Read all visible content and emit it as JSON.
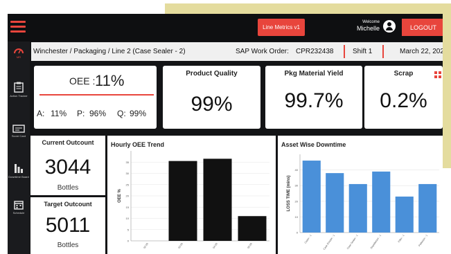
{
  "topbar": {
    "metrics_label": "Line Metrics v1",
    "welcome_label": "Welcome",
    "user_name": "Michelle",
    "logout_label": "LOGOUT",
    "accent_color": "#e8453c"
  },
  "sidebar": {
    "items": [
      {
        "label": "MR",
        "icon": "gauge-icon"
      },
      {
        "label": "Action Tracker",
        "icon": "clipboard-icon"
      },
      {
        "label": "Score Card",
        "icon": "scorecard-icon"
      },
      {
        "label": "Downtime Board",
        "icon": "bar-chart-icon"
      },
      {
        "label": "Schedule",
        "icon": "calendar-icon"
      }
    ]
  },
  "infobar": {
    "breadcrumb": "Winchester / Packaging / Line 2 (Case Sealer - 2)",
    "work_order_label": "SAP Work Order:",
    "work_order_value": "CPR232438",
    "shift": "Shift 1",
    "date": "March 22, 202"
  },
  "kpis": {
    "oee": {
      "label": "OEE :",
      "value": "11%",
      "a_label": "A:",
      "a_value": "11%",
      "p_label": "P:",
      "p_value": "96%",
      "q_label": "Q:",
      "q_value": "99%"
    },
    "quality": {
      "title": "Product Quality",
      "value": "99%"
    },
    "yield": {
      "title": "Pkg Material Yield",
      "value": "99.7%"
    },
    "scrap": {
      "title": "Scrap",
      "value": "0.2%"
    }
  },
  "outcomes": {
    "current": {
      "title": "Current Outcount",
      "value": "3044",
      "unit": "Bottles"
    },
    "target": {
      "title": "Target Outcount",
      "value": "5011",
      "unit": "Bottles"
    }
  },
  "chart_data": [
    {
      "type": "bar",
      "title": "Hourly OEE Trend",
      "ylabel": "OEE %",
      "xlabel": "",
      "categories": [
        "02:00",
        "03:00",
        "04:00",
        "05:00"
      ],
      "values": [
        0,
        35.5,
        36.5,
        11
      ],
      "ylim": [
        0,
        40
      ],
      "yticks": [
        0,
        5,
        10,
        15,
        20,
        25,
        30,
        35
      ],
      "grid": true,
      "color": "#111111"
    },
    {
      "type": "bar",
      "title": "Asset Wise Downtime",
      "ylabel": "LOSS TIME (mins)",
      "xlabel": "",
      "categories": [
        "Caser - 1",
        "Case Erector - 1",
        "Case Sealer - 1",
        "Depalletizer - 1",
        "Filler - 1",
        "Palletizer - 1"
      ],
      "values": [
        46,
        38,
        31,
        39,
        23,
        31
      ],
      "ylim": [
        0,
        50
      ],
      "yticks": [
        0,
        10,
        20,
        30,
        40
      ],
      "grid": true,
      "color": "#4a90d9"
    }
  ]
}
